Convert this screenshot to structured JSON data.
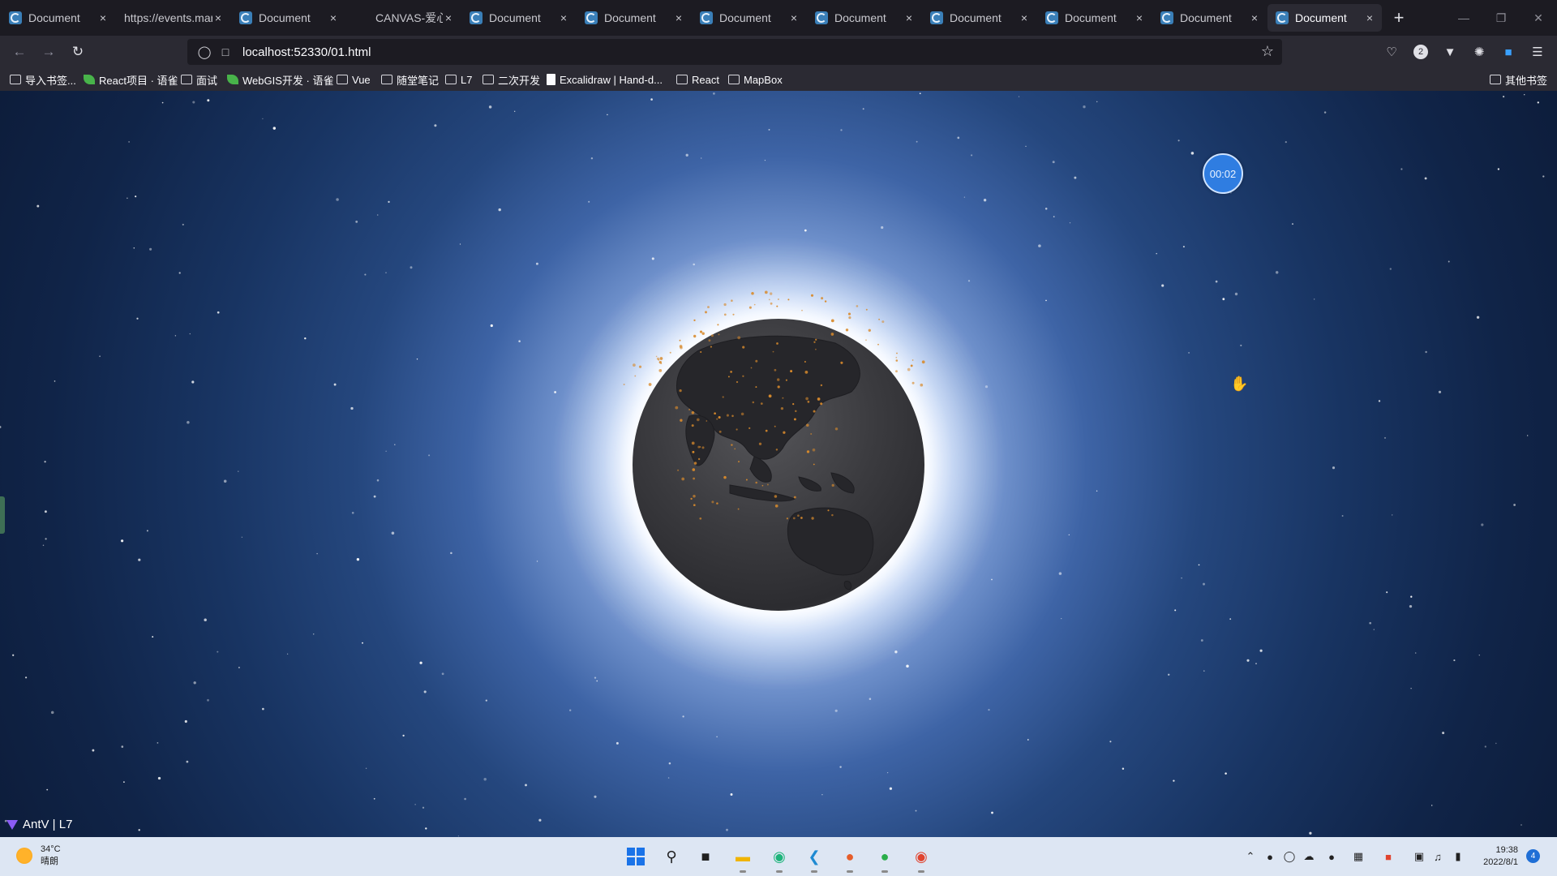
{
  "browser": {
    "tabs": [
      {
        "title": "Document",
        "favicon": "document-icon"
      },
      {
        "title": "https://events.mar",
        "favicon": "none"
      },
      {
        "title": "Document",
        "favicon": "document-icon"
      },
      {
        "title": "CANVAS-爱心",
        "favicon": "web-icon"
      },
      {
        "title": "Document",
        "favicon": "document-icon"
      },
      {
        "title": "Document",
        "favicon": "document-icon"
      },
      {
        "title": "Document",
        "favicon": "document-icon"
      },
      {
        "title": "Document",
        "favicon": "document-icon"
      },
      {
        "title": "Document",
        "favicon": "document-icon"
      },
      {
        "title": "Document",
        "favicon": "document-icon"
      },
      {
        "title": "Document",
        "favicon": "document-icon"
      },
      {
        "title": "Document",
        "favicon": "document-icon",
        "active": true
      }
    ],
    "address": "localhost:52330/01.html",
    "extension_badge": "2",
    "bookmarks": [
      {
        "label": "导入书签...",
        "icon": "import-icon"
      },
      {
        "label": "React项目 · 语雀",
        "icon": "leaf-icon"
      },
      {
        "label": "面试",
        "icon": "folder-icon"
      },
      {
        "label": "WebGIS开发 · 语雀",
        "icon": "leaf-icon"
      },
      {
        "label": "Vue",
        "icon": "folder-icon"
      },
      {
        "label": "随堂笔记",
        "icon": "folder-icon"
      },
      {
        "label": "L7",
        "icon": "folder-icon"
      },
      {
        "label": "二次开发",
        "icon": "folder-icon"
      },
      {
        "label": "Excalidraw | Hand-d...",
        "icon": "doc-icon"
      },
      {
        "label": "React",
        "icon": "folder-icon"
      },
      {
        "label": "MapBox",
        "icon": "folder-icon"
      }
    ],
    "other_bookmarks": "其他书签"
  },
  "page": {
    "timer": "00:02",
    "logo_text": "AntV | L7"
  },
  "taskbar": {
    "weather_temp": "34°C",
    "weather_desc": "晴朗",
    "time": "19:38",
    "date": "2022/8/1",
    "notifications": "4"
  },
  "colors": {
    "accent": "#2f7de1",
    "glow": "#ffffff",
    "space": "#0b1934",
    "particles": "#d88a2c"
  }
}
